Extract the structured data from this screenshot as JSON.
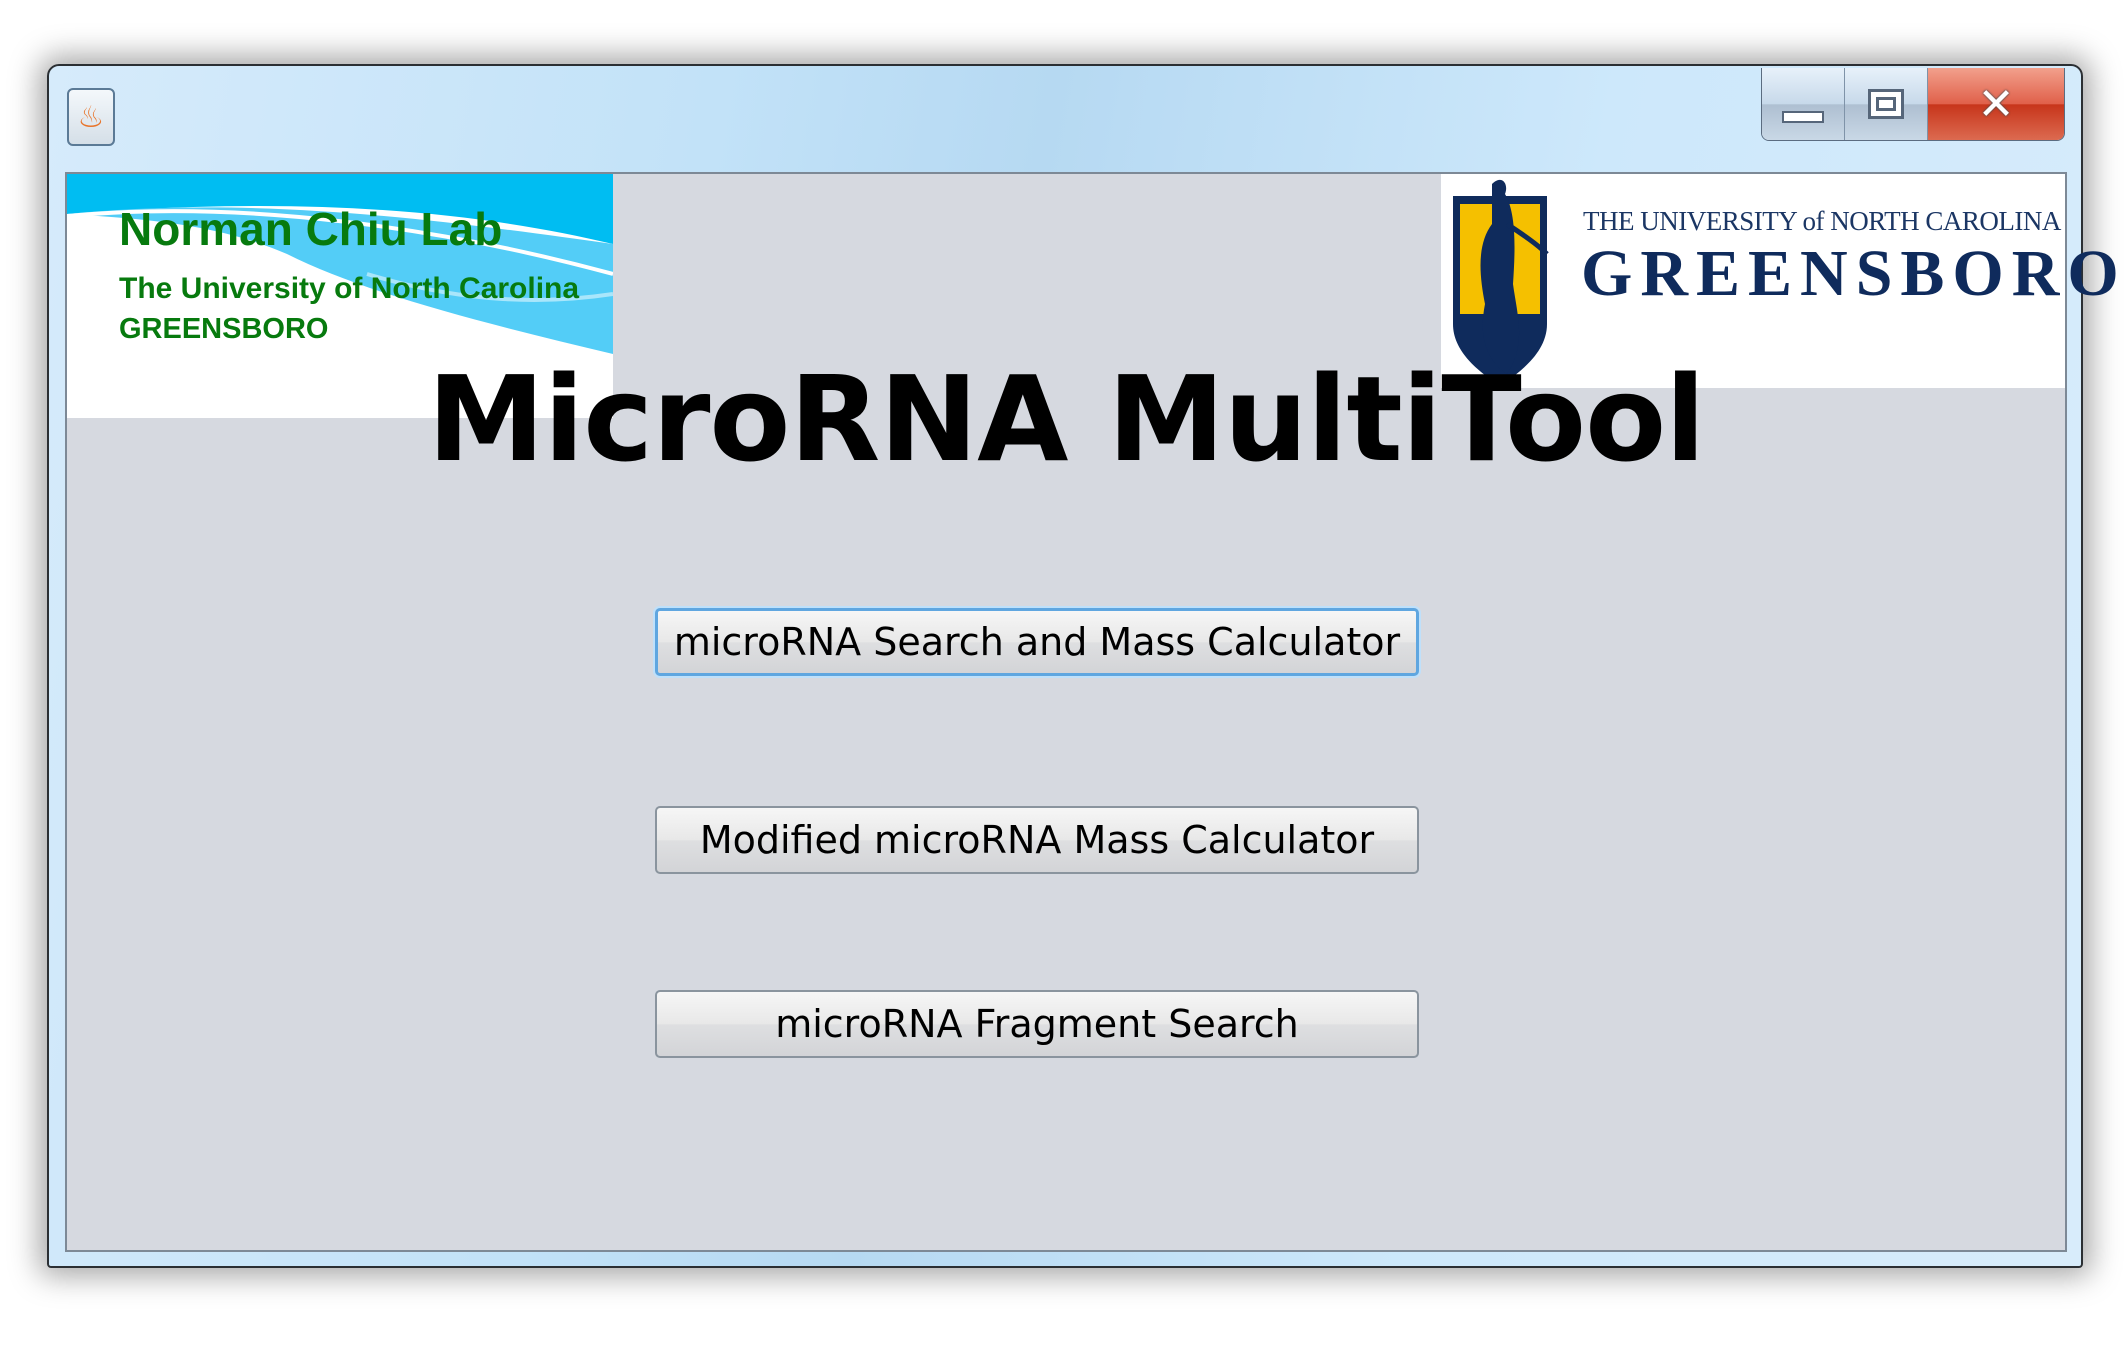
{
  "window": {
    "controls": {
      "minimize": "minimize",
      "maximize": "maximize",
      "close": "close"
    }
  },
  "lab_logo": {
    "name": "Norman Chiu Lab",
    "university": "The University of North Carolina",
    "campus": "GREENSBORO"
  },
  "uncg_logo": {
    "line1": "THE UNIVERSITY of NORTH CAROLINA",
    "line2": "GREENSBORO"
  },
  "main": {
    "title": "MicroRNA MultiTool",
    "buttons": [
      {
        "label": "microRNA Search and Mass Calculator",
        "focused": true
      },
      {
        "label": "Modified microRNA Mass Calculator"
      },
      {
        "label": "microRNA Fragment Search"
      }
    ]
  },
  "colors": {
    "lab_green": "#077a0e",
    "uncg_navy": "#0f2b5c",
    "uncg_gold": "#f5c000",
    "panel_bg": "#d6d9e0"
  }
}
